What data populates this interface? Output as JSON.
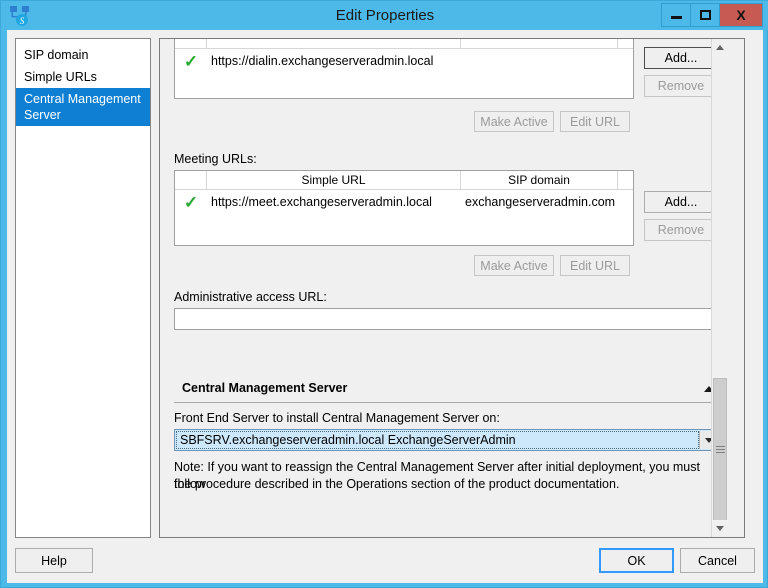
{
  "window": {
    "title": "Edit Properties",
    "app_icon": "topology-builder-icon",
    "controls": {
      "minimize": "minimize-icon",
      "maximize": "maximize-icon",
      "close": "X"
    },
    "accent_color": "#4cb9e8",
    "close_color": "#c75b53"
  },
  "sidebar": {
    "items": [
      {
        "label": "SIP domain",
        "selected": false
      },
      {
        "label": "Simple URLs",
        "selected": false
      },
      {
        "label": "Central Management Server",
        "selected": true
      }
    ],
    "selected_color": "#0f7fd4"
  },
  "dialin_section": {
    "rows": [
      {
        "status": "✓",
        "simple_url": "https://dialin.exchangeserveradmin.local",
        "sip_domain": ""
      }
    ],
    "buttons": {
      "add": "Add...",
      "remove": "Remove",
      "make_active": "Make Active",
      "edit_url": "Edit URL"
    }
  },
  "meeting_section": {
    "label": "Meeting URLs:",
    "columns": [
      "",
      "Simple URL",
      "SIP domain",
      ""
    ],
    "rows": [
      {
        "status": "✓",
        "simple_url": "https://meet.exchangeserveradmin.local",
        "sip_domain": "exchangeserveradmin.com"
      }
    ],
    "buttons": {
      "add": "Add...",
      "remove": "Remove",
      "make_active": "Make Active",
      "edit_url": "Edit URL"
    }
  },
  "admin_url": {
    "label": "Administrative access URL:",
    "value": "",
    "placeholder": ""
  },
  "cms_section": {
    "header": "Central Management Server",
    "chevron": "chevron-up-icon",
    "field_label": "Front End Server to install Central Management Server on:",
    "selected_server": "SBFSRV.exchangeserveradmin.local   ExchangeServerAdmin",
    "note_line1": "Note: If you want to reassign the Central Management Server after initial deployment, you must follow",
    "note_line2": "the procedure described in the Operations section of the product documentation."
  },
  "scrollbar": {
    "up_arrow": "scroll-up-icon",
    "down_arrow": "scroll-down-icon",
    "thumb": "scroll-thumb"
  },
  "footer": {
    "help": "Help",
    "ok": "OK",
    "cancel": "Cancel"
  }
}
